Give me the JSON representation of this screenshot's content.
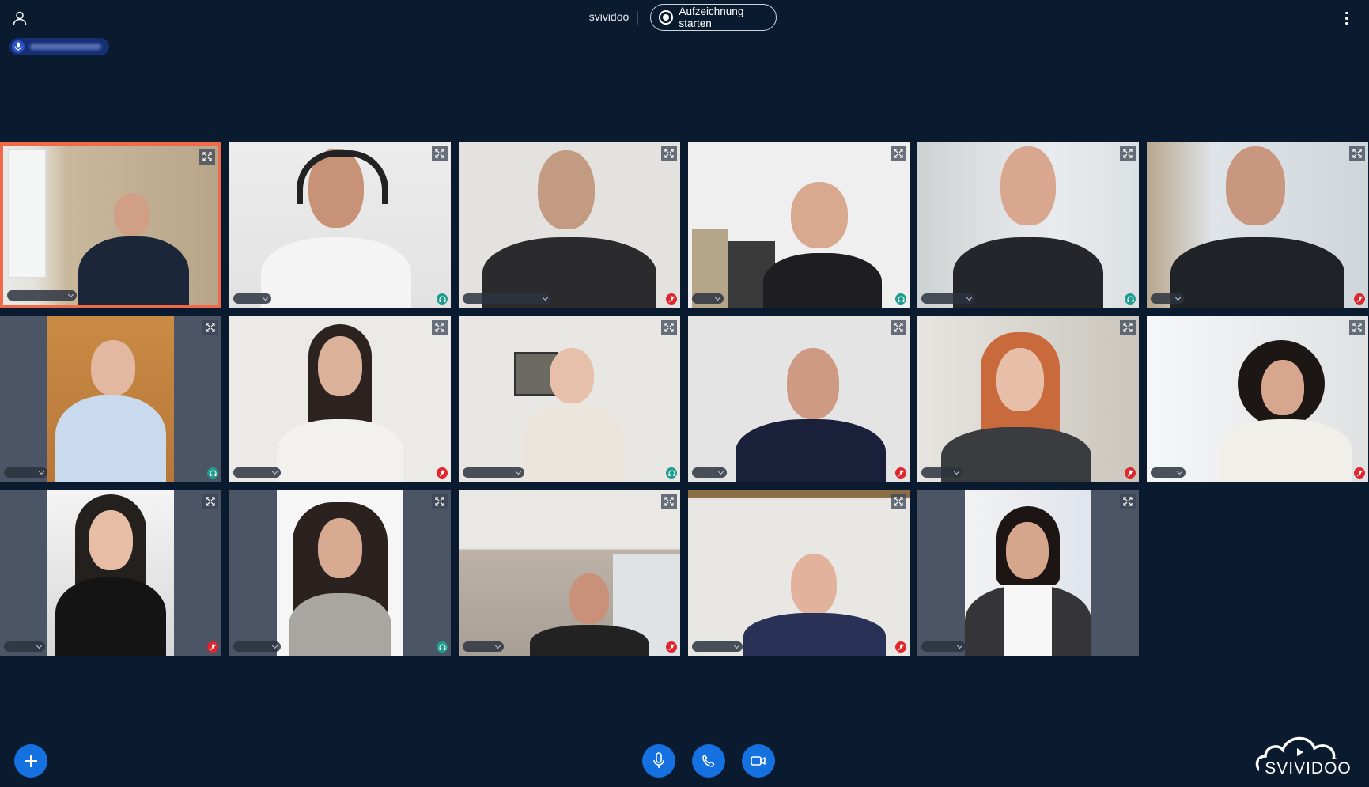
{
  "header": {
    "room_name": "svividoo",
    "record_label": "Aufzeichnung starten"
  },
  "speaker": {
    "icon": "mic-icon",
    "name_blurred": true
  },
  "participants": [
    {
      "tile": 1,
      "status": "speaking",
      "active": true
    },
    {
      "tile": 2,
      "status": "listening"
    },
    {
      "tile": 3,
      "status": "muted"
    },
    {
      "tile": 4,
      "status": "listening"
    },
    {
      "tile": 5,
      "status": "listening"
    },
    {
      "tile": 6,
      "status": "muted"
    },
    {
      "tile": 7,
      "status": "listening"
    },
    {
      "tile": 8,
      "status": "muted"
    },
    {
      "tile": 9,
      "status": "listening"
    },
    {
      "tile": 10,
      "status": "muted"
    },
    {
      "tile": 11,
      "status": "muted"
    },
    {
      "tile": 12,
      "status": "muted"
    },
    {
      "tile": 13,
      "status": "muted"
    },
    {
      "tile": 14,
      "status": "listening"
    },
    {
      "tile": 15,
      "status": "muted"
    },
    {
      "tile": 16,
      "status": "muted"
    },
    {
      "tile": 17,
      "status": "none"
    }
  ],
  "controls": {
    "add": "plus-icon",
    "mic": "mic-icon",
    "phone": "phone-icon",
    "camera": "video-icon"
  },
  "brand": {
    "logo_text": "SVIVIDOO"
  },
  "colors": {
    "background": "#0a1a2f",
    "active_border": "#f06a4a",
    "button_blue": "#1570e0",
    "muted_red": "#e0262c",
    "listen_teal": "#1f9e8f"
  }
}
